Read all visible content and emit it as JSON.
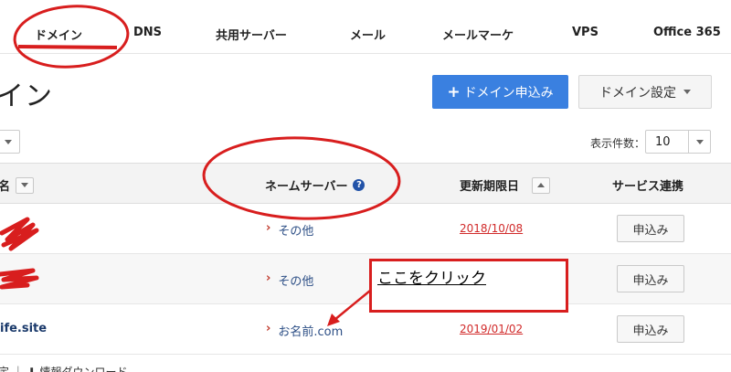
{
  "nav": {
    "tabs": [
      {
        "label": "ドメイン"
      },
      {
        "label": "DNS"
      },
      {
        "label": "共用サーバー"
      },
      {
        "label": "メール"
      },
      {
        "label": "メールマーケ"
      },
      {
        "label": "VPS"
      },
      {
        "label": "Office 365"
      }
    ]
  },
  "page": {
    "title": "イン"
  },
  "actions": {
    "apply_domain_label": "ドメイン申込み",
    "domain_settings_label": "ドメイン設定"
  },
  "list_controls": {
    "per_page_label": "表示件数：",
    "per_page_value": "10"
  },
  "table": {
    "headers": {
      "domain": "名",
      "nameserver": "ネームサーバー",
      "expiry": "更新期限日",
      "service": "サービス連携"
    },
    "rows": [
      {
        "domain": "",
        "nameserver": "その他",
        "expiry": "2018/10/08",
        "action": "申込み"
      },
      {
        "domain": "",
        "nameserver": "その他",
        "expiry": "",
        "action": "申込み"
      },
      {
        "domain": "ife.site",
        "nameserver": "お名前.com",
        "expiry": "2019/01/02",
        "action": "申込み"
      }
    ]
  },
  "footer": {
    "text": "定 ｜ ⬇ 情報ダウンロード"
  },
  "annotation": {
    "text": "ここをクリック"
  },
  "colors": {
    "accent_blue": "#3a80e0",
    "annotation_red": "#d81e1e",
    "date_red": "#d12b2b"
  }
}
